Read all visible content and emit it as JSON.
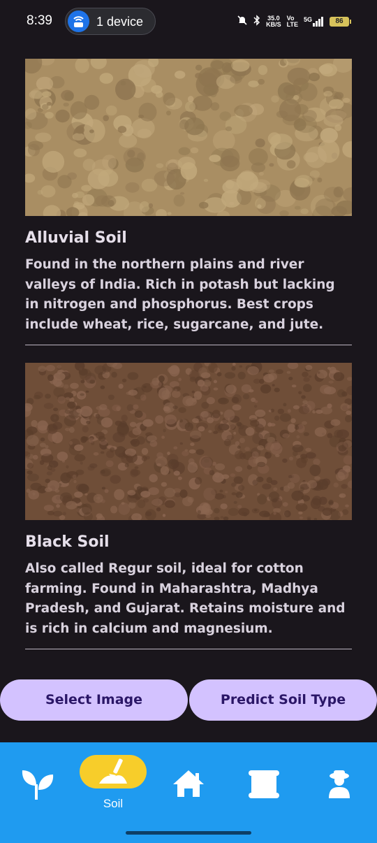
{
  "status_bar": {
    "time": "8:39",
    "hotspot_label": "1 device",
    "speed_value": "35.0",
    "speed_unit": "KB/S",
    "net_vo": "Vo",
    "net_lte": "LTE",
    "net_5g": "5G",
    "battery": "86"
  },
  "soils": [
    {
      "title": "Alluvial Soil",
      "description": "Found in the northern plains and river valleys of India. Rich in potash but lacking in nitrogen and phosphorus. Best crops include wheat, rice, sugarcane, and jute.",
      "image_palette": [
        "#a98e63",
        "#8e7550",
        "#c2a97c"
      ]
    },
    {
      "title": "Black Soil",
      "description": "Also called Regur soil, ideal for cotton farming. Found in Maharashtra, Madhya Pradesh, and Gujarat. Retains moisture and is rich in calcium and magnesium.",
      "image_palette": [
        "#6f4e38",
        "#5a3d2b",
        "#8a6550"
      ]
    }
  ],
  "actions": {
    "select_image": "Select Image",
    "predict": "Predict Soil Type"
  },
  "bottom_nav": {
    "items": [
      {
        "icon": "sprout-icon",
        "label": ""
      },
      {
        "icon": "soil-icon",
        "label": "Soil"
      },
      {
        "icon": "home-icon",
        "label": ""
      },
      {
        "icon": "scroll-icon",
        "label": ""
      },
      {
        "icon": "farmer-profile-icon",
        "label": ""
      }
    ],
    "active_index": 1
  },
  "colors": {
    "background": "#1a161c",
    "button_bg": "#d3c2ff",
    "button_text": "#2a1667",
    "nav_bg": "#1f9bf0",
    "active_pill": "#f7cd2a"
  }
}
